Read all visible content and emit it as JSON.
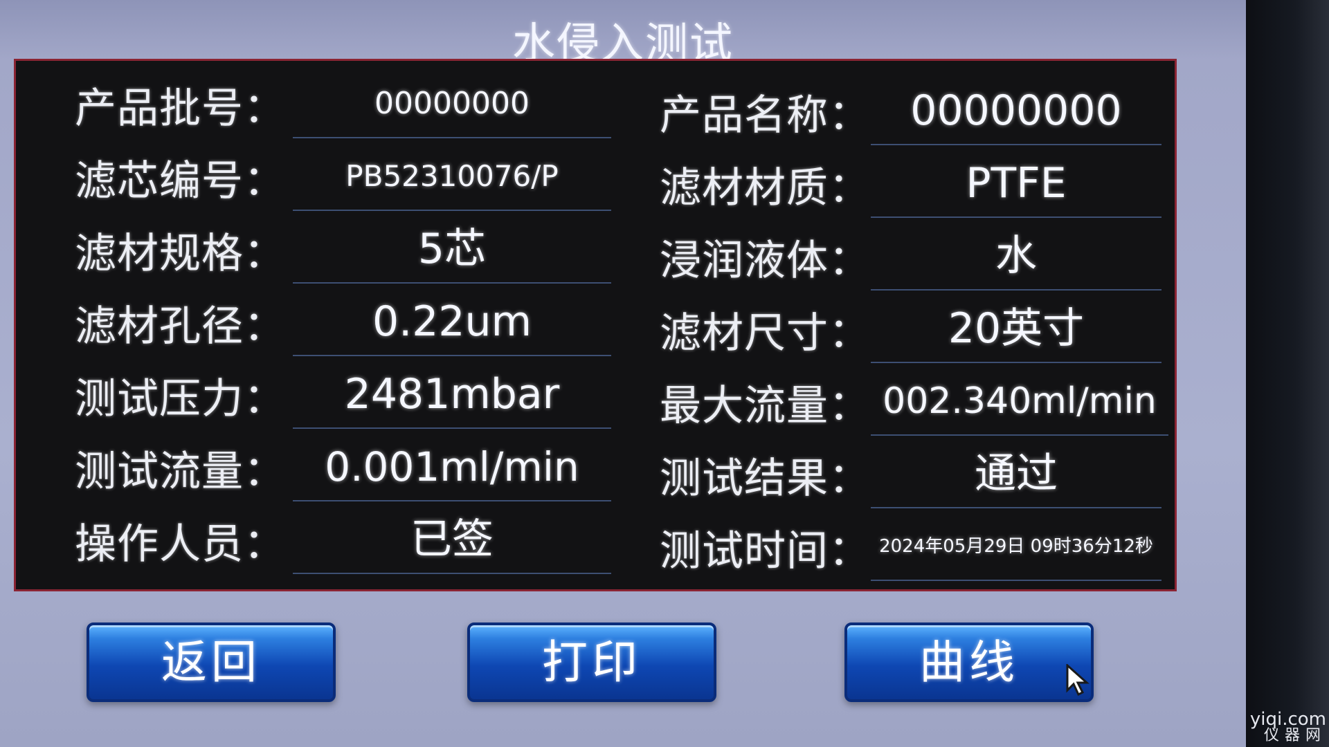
{
  "title": "水侵入测试",
  "fields": [
    {
      "label": "产品批号：",
      "value": "00000000"
    },
    {
      "label": "滤芯编号：",
      "value": "PB52310076/P"
    },
    {
      "label": "滤材规格：",
      "value": "5芯"
    },
    {
      "label": "滤材孔径：",
      "value": "0.22um"
    },
    {
      "label": "测试压力：",
      "value": "2481mbar"
    },
    {
      "label": "测试流量：",
      "value": "0.001ml/min"
    },
    {
      "label": "操作人员：",
      "value": "已签"
    },
    {
      "label": "产品名称：",
      "value": "00000000"
    },
    {
      "label": "滤材材质：",
      "value": "PTFE"
    },
    {
      "label": "浸润液体：",
      "value": "水"
    },
    {
      "label": "滤材尺寸：",
      "value": "20英寸"
    },
    {
      "label": "最大流量：",
      "value": "002.340ml/min"
    },
    {
      "label": "测试结果：",
      "value": "通过"
    },
    {
      "label": "测试时间：",
      "value": "2024年05月29日 09时36分12秒"
    }
  ],
  "buttons": {
    "back": "返回",
    "print": "打印",
    "curve": "曲线"
  },
  "watermark": {
    "top": "yiqi.com",
    "bottom": "仪器网"
  },
  "icons": {
    "cursor": "mouse-pointer-icon"
  }
}
